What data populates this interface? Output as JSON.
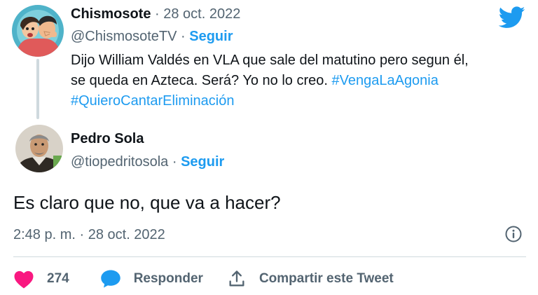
{
  "parent_tweet": {
    "author_name": "Chismosote",
    "date_suffix": " · 28 oct. 2022",
    "handle": "@ChismosoteTV",
    "separator": " · ",
    "follow_label": "Seguir",
    "text_line1": "Dijo William Valdés en VLA que sale del matutino pero segun él,",
    "text_line2": "se queda en Azteca. Será? Yo no lo creo. ",
    "hashtag1": "#VengaLaAgonia",
    "hashtag2": "#QuieroCantarEliminación"
  },
  "reply_tweet": {
    "author_name": "Pedro Sola",
    "handle": "@tiopedritosola",
    "separator": " · ",
    "follow_label": "Seguir",
    "text": "Es claro que no, que va a hacer?",
    "timestamp": "2:48 p. m. · 28 oct. 2022"
  },
  "actions": {
    "like_count": "274",
    "reply_label": "Responder",
    "share_label": "Compartir este Tweet"
  },
  "icons": {
    "brand": "twitter-bird-icon",
    "info": "info-icon",
    "like": "heart-icon",
    "reply": "speech-bubble-icon",
    "share": "share-icon"
  },
  "colors": {
    "accent": "#1d9bf0",
    "like": "#f91880",
    "text": "#0f1419",
    "secondary": "#536471",
    "border": "#cfd9de"
  }
}
